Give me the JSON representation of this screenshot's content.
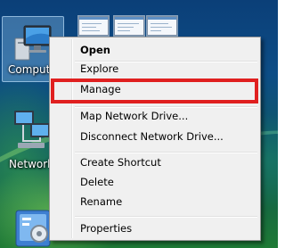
{
  "desktop": {
    "icons": [
      {
        "name": "computer",
        "label": "Compute"
      },
      {
        "name": "network",
        "label": "Network"
      },
      {
        "name": "control-panel",
        "label": ""
      }
    ]
  },
  "context_menu": {
    "items": [
      {
        "id": "open",
        "label": "Open",
        "bold": true
      },
      {
        "id": "explore",
        "label": "Explore"
      },
      {
        "id": "manage",
        "label": "Manage",
        "highlighted": true
      },
      {
        "id": "map-network-drive",
        "label": "Map Network Drive..."
      },
      {
        "id": "disconnect-network-drive",
        "label": "Disconnect Network Drive..."
      },
      {
        "id": "create-shortcut",
        "label": "Create Shortcut"
      },
      {
        "id": "delete",
        "label": "Delete"
      },
      {
        "id": "rename",
        "label": "Rename"
      },
      {
        "id": "properties",
        "label": "Properties"
      }
    ]
  },
  "colors": {
    "highlight_border": "#e02020",
    "menu_background": "#f0f0f0",
    "menu_border": "#979797"
  }
}
